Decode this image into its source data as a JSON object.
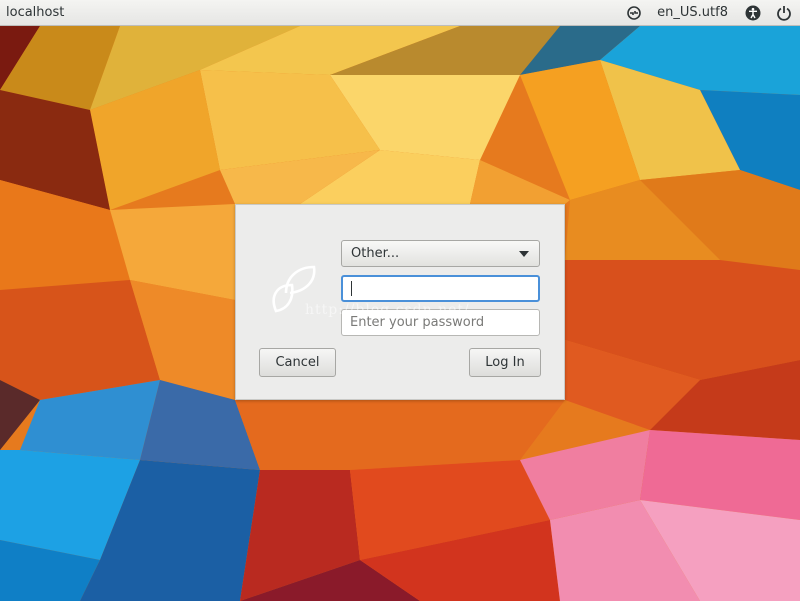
{
  "topbar": {
    "hostname": "localhost",
    "locale": "en_US.utf8",
    "icons": [
      "orca-screen-reader-icon",
      "accessibility-icon",
      "power-icon"
    ]
  },
  "login": {
    "user_select_value": "Other...",
    "username_value": "",
    "password_placeholder": "Enter your password",
    "cancel_label": "Cancel",
    "login_label": "Log In",
    "logo_icon": "leaf-logo-icon"
  },
  "watermark": "http://blog.csdn.net/",
  "colors": {
    "focus_border": "#4a90d9",
    "dialog_bg": "#ececeb"
  }
}
